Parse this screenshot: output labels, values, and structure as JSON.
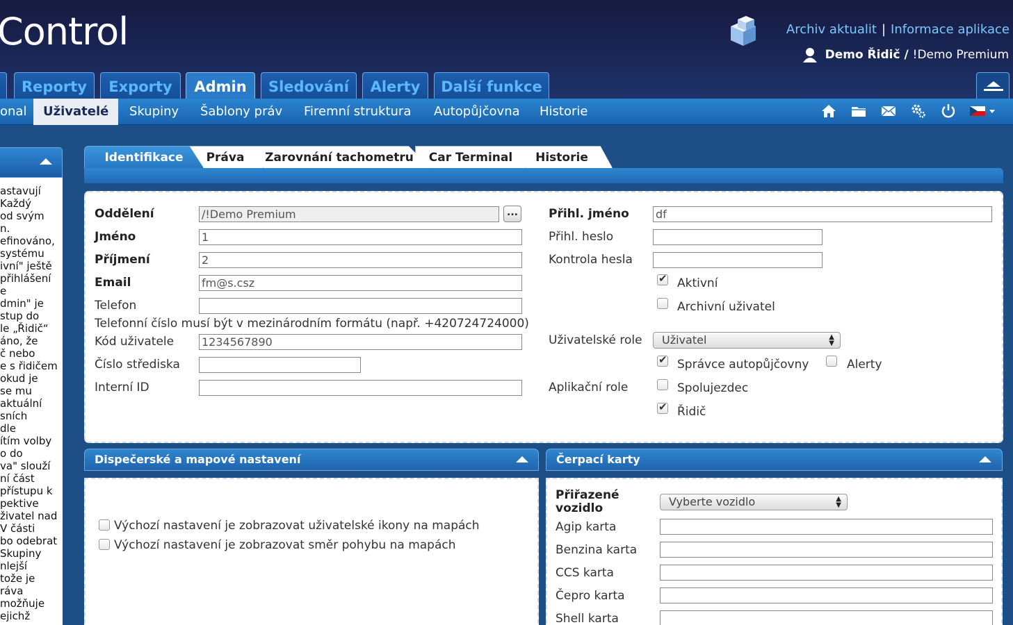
{
  "header": {
    "app_title": "Control",
    "links": {
      "news_archive": "Archiv aktualit",
      "separator": "|",
      "app_info": "Informace aplikace"
    },
    "user": {
      "name": "Demo Řidič",
      "separator": "/",
      "account": "!Demo Premium"
    }
  },
  "main_tabs": [
    "Reporty",
    "Exporty",
    "Admin",
    "Sledování",
    "Alerty",
    "Další funkce"
  ],
  "main_tab_active": "Admin",
  "sub_nav": [
    "onal",
    "Uživatelé",
    "Skupiny",
    "Šablony práv",
    "Firemní struktura",
    "Autopůjčovna",
    "Historie"
  ],
  "sub_nav_active": "Uživatelé",
  "nav_icons": [
    "home-icon",
    "folder-icon",
    "mail-icon",
    "settings-icon",
    "power-icon",
    "czech-flag-icon"
  ],
  "left_panel_text": [
    "astavují",
    "Každý",
    "od svým",
    "n.",
    "efinováno,",
    "systému",
    "ivní\" ještě",
    "přihlášení",
    "e",
    "dmin\" je",
    "stup do",
    "le „Řidič“",
    "áno, že",
    "č nebo",
    "e s řidičem",
    "okud je",
    "se mu",
    "aktuální",
    "sních",
    "dle",
    "ítím volby",
    "o do",
    "va\" slouží",
    "ní část",
    "přístupu k",
    "pektive",
    "živatel nad",
    "V části",
    "bo odebrat",
    "Skupiny",
    "nlejší",
    "tože je",
    "ráva",
    "možňuje",
    "ejichž"
  ],
  "form_tabs": [
    "Identifikace",
    "Práva",
    "Zarovnání tachometru",
    "Car Terminal",
    "Historie"
  ],
  "form_tab_active": "Identifikace",
  "ident": {
    "department_label": "Oddělení",
    "department_value": "/!Demo Premium",
    "browse_button": "...",
    "first_name_label": "Jméno",
    "first_name_value": "1",
    "last_name_label": "Příjmení",
    "last_name_value": "2",
    "email_label": "Email",
    "email_value": "fm@s.csz",
    "phone_label": "Telefon",
    "phone_value": "",
    "phone_hint": "Telefonní číslo musí být v mezinárodním formátu (např. +420724724000)",
    "user_code_label": "Kód uživatele",
    "user_code_value": "1234567890",
    "cost_center_label": "Číslo střediska",
    "cost_center_value": "",
    "internal_id_label": "Interní ID",
    "internal_id_value": "",
    "login_label": "Přihl. jméno",
    "login_value": "df",
    "password_label": "Přihl. heslo",
    "password_value": "",
    "password_confirm_label": "Kontrola hesla",
    "password_confirm_value": "",
    "active_label": "Aktivní",
    "active_checked": true,
    "archived_label": "Archivní uživatel",
    "archived_checked": false,
    "user_role_label": "Uživatelské role",
    "user_role_value": "Uživatel",
    "rental_admin_label": "Správce autopůjčovny",
    "rental_admin_checked": true,
    "alerts_label": "Alerty",
    "alerts_checked": false,
    "app_role_label": "Aplikační role",
    "codriver_label": "Spolujezdec",
    "codriver_checked": false,
    "driver_label": "Řidič",
    "driver_checked": true
  },
  "dispatch": {
    "title": "Dispečerské a mapové nastavení",
    "show_user_icons_label": "Výchozí nastavení je zobrazovat uživatelské ikony na mapách",
    "show_user_icons_checked": false,
    "show_direction_label": "Výchozí nastavení je zobrazovat směr pohybu na mapách",
    "show_direction_checked": false
  },
  "fuel_cards": {
    "title": "Čerpací karty",
    "assigned_vehicles_label_1": "Přiřazené",
    "assigned_vehicles_label_2": "vozidlo",
    "vehicle_select_value": "Vyberte vozidlo",
    "agip_label": "Agip karta",
    "agip_value": "",
    "benzina_label": "Benzina karta",
    "benzina_value": "",
    "ccs_label": "CCS karta",
    "ccs_value": "",
    "cepro_label": "Čepro karta",
    "cepro_value": "",
    "shell_label": "Shell karta",
    "shell_value": ""
  },
  "colors": {
    "header_bg": "#161a40",
    "tab_blue": "#1d5fae",
    "link_blue": "#7fc8ff",
    "subnav_blue": "#2a84cf",
    "page_bg": "#1d4f86"
  }
}
